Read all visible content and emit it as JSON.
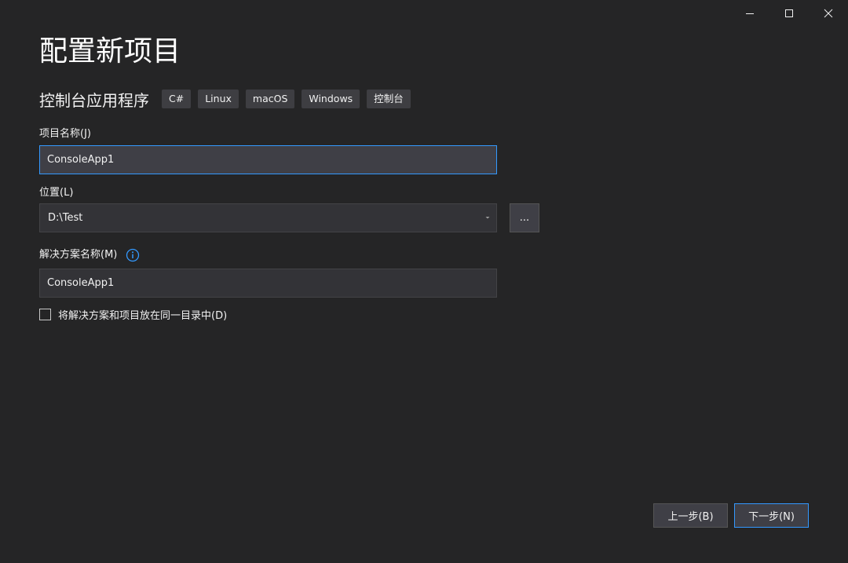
{
  "window": {
    "caption_buttons": {
      "minimize_icon": "minimize-icon",
      "maximize_icon": "maximize-icon",
      "close_icon": "close-icon"
    }
  },
  "page": {
    "title": "配置新项目"
  },
  "template": {
    "name": "控制台应用程序",
    "tags": [
      "C#",
      "Linux",
      "macOS",
      "Windows",
      "控制台"
    ]
  },
  "project_name": {
    "label": "项目名称(J)",
    "value": "ConsoleApp1"
  },
  "location": {
    "label": "位置(L)",
    "value": "D:\\Test",
    "browse_label": "..."
  },
  "solution_name": {
    "label": "解决方案名称(M)",
    "value": "ConsoleApp1",
    "info_icon": "info-icon"
  },
  "same_directory": {
    "label": "将解决方案和项目放在同一目录中(D)",
    "checked": false
  },
  "footer": {
    "back_label": "上一步(B)",
    "next_label": "下一步(N)"
  },
  "colors": {
    "background": "#252526",
    "input_background": "#333337",
    "focus_border": "#3399ff",
    "accent": "#3399ff"
  }
}
